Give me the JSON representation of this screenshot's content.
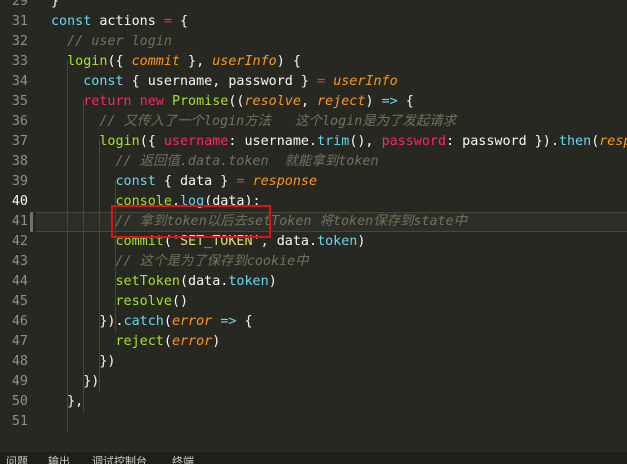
{
  "gutter": {
    "line_numbers": [
      "29",
      "31",
      "32",
      "33",
      "34",
      "35",
      "36",
      "37",
      "38",
      "39",
      "40",
      "41",
      "42",
      "43",
      "44",
      "45",
      "46",
      "47",
      "48",
      "49",
      "50",
      "51"
    ],
    "active": "40"
  },
  "code": [
    [
      {
        "t": "}",
        "c": ""
      }
    ],
    [
      {
        "t": "const ",
        "c": "kw"
      },
      {
        "t": "actions ",
        "c": ""
      },
      {
        "t": "= ",
        "c": "st"
      },
      {
        "t": "{",
        "c": ""
      }
    ],
    [
      {
        "t": "  // user login",
        "c": "cm"
      }
    ],
    [
      {
        "t": "  login",
        "c": "fn"
      },
      {
        "t": "({ ",
        "c": ""
      },
      {
        "t": "commit",
        "c": "pr"
      },
      {
        "t": " }, ",
        "c": ""
      },
      {
        "t": "userInfo",
        "c": "pr"
      },
      {
        "t": ") {",
        "c": ""
      }
    ],
    [
      {
        "t": "    const ",
        "c": "kw"
      },
      {
        "t": "{ username, password } ",
        "c": ""
      },
      {
        "t": "= ",
        "c": "st"
      },
      {
        "t": "userInfo",
        "c": "pr"
      }
    ],
    [
      {
        "t": "    return ",
        "c": "st"
      },
      {
        "t": "new ",
        "c": "st"
      },
      {
        "t": "Promise",
        "c": "fn"
      },
      {
        "t": "((",
        "c": ""
      },
      {
        "t": "resolve",
        "c": "pr"
      },
      {
        "t": ", ",
        "c": ""
      },
      {
        "t": "reject",
        "c": "pr"
      },
      {
        "t": ") ",
        "c": ""
      },
      {
        "t": "=> ",
        "c": "kw"
      },
      {
        "t": "{",
        "c": ""
      }
    ],
    [
      {
        "t": "      // 又传入了一个login方法   这个login是为了发起请求",
        "c": "cm"
      }
    ],
    [
      {
        "t": "      login",
        "c": "fn"
      },
      {
        "t": "({ ",
        "c": ""
      },
      {
        "t": "username",
        "c": "st"
      },
      {
        "t": ": username.",
        "c": ""
      },
      {
        "t": "trim",
        "c": "kw"
      },
      {
        "t": "(), ",
        "c": ""
      },
      {
        "t": "password",
        "c": "st"
      },
      {
        "t": ": password }).",
        "c": ""
      },
      {
        "t": "then",
        "c": "kw"
      },
      {
        "t": "(",
        "c": ""
      },
      {
        "t": "response",
        "c": "pr"
      }
    ],
    [
      {
        "t": "        // 返回值.data.token  就能拿到token",
        "c": "cm"
      }
    ],
    [
      {
        "t": "        const ",
        "c": "kw"
      },
      {
        "t": "{ data } ",
        "c": ""
      },
      {
        "t": "= ",
        "c": "st"
      },
      {
        "t": "response",
        "c": "pr"
      }
    ],
    [
      {
        "t": "        console",
        "c": "fn"
      },
      {
        "t": ".",
        "c": ""
      },
      {
        "t": "log",
        "c": "kw"
      },
      {
        "t": "(data);",
        "c": ""
      }
    ],
    [
      {
        "t": "        // 拿到token以后去setToken 将token保存到state中",
        "c": "cm"
      }
    ],
    [
      {
        "t": "        commit",
        "c": "fn"
      },
      {
        "t": "(",
        "c": ""
      },
      {
        "t": "'SET_TOKEN'",
        "c": "str"
      },
      {
        "t": ", data.",
        "c": ""
      },
      {
        "t": "token",
        "c": "kw"
      },
      {
        "t": ")",
        "c": ""
      }
    ],
    [
      {
        "t": "        // 这个是为了保存到cookie中",
        "c": "cm"
      }
    ],
    [
      {
        "t": "        setToken",
        "c": "fn"
      },
      {
        "t": "(data.",
        "c": ""
      },
      {
        "t": "token",
        "c": "kw"
      },
      {
        "t": ")",
        "c": ""
      }
    ],
    [
      {
        "t": "        resolve",
        "c": "fn"
      },
      {
        "t": "()",
        "c": ""
      }
    ],
    [
      {
        "t": "      }).",
        "c": ""
      },
      {
        "t": "catch",
        "c": "kw"
      },
      {
        "t": "(",
        "c": ""
      },
      {
        "t": "error",
        "c": "pr"
      },
      {
        "t": " ",
        "c": ""
      },
      {
        "t": "=> ",
        "c": "kw"
      },
      {
        "t": "{",
        "c": ""
      }
    ],
    [
      {
        "t": "        reject",
        "c": "fn"
      },
      {
        "t": "(",
        "c": ""
      },
      {
        "t": "error",
        "c": "pr"
      },
      {
        "t": ")",
        "c": ""
      }
    ],
    [
      {
        "t": "      })",
        "c": ""
      }
    ],
    [
      {
        "t": "    })",
        "c": ""
      }
    ],
    [
      {
        "t": "  },",
        "c": ""
      }
    ],
    [
      {
        "t": "",
        "c": ""
      }
    ]
  ],
  "status_tabs": [
    "问题",
    "输出",
    "调试控制台",
    "终端"
  ]
}
